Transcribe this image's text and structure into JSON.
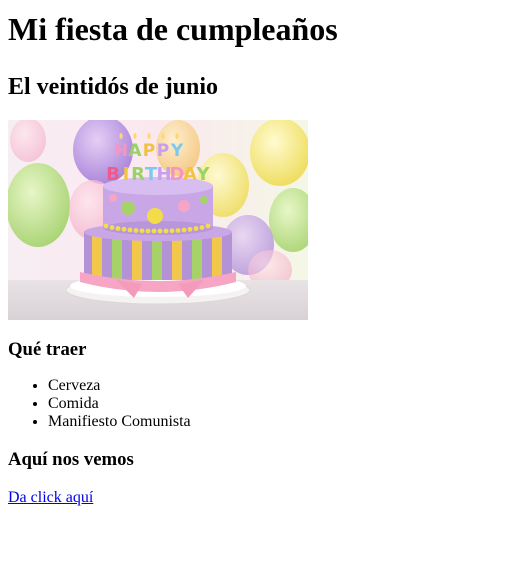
{
  "page": {
    "title": "Mi fiesta de cumpleaños",
    "date_heading": "El veintidós de junio",
    "image": {
      "cake_text": "HAPPY BIRTHDAY",
      "colors": {
        "background": "#f4e9ee",
        "cake_purple": "#b392d6",
        "cake_top": "#c9a7e6",
        "dots_yellow": "#f3dc4a",
        "stripes_yellow": "#f1c84b",
        "stripes_green": "#a7d26a",
        "ribbon_pink": "#f6a6c4",
        "plate": "#f2f0ee"
      }
    },
    "bring_heading": "Qué traer",
    "bring_items": [
      "Cerveza",
      "Comida",
      "Manifiesto Comunista"
    ],
    "meet_heading": "Aquí nos vemos",
    "link_text": "Da click aquí"
  }
}
